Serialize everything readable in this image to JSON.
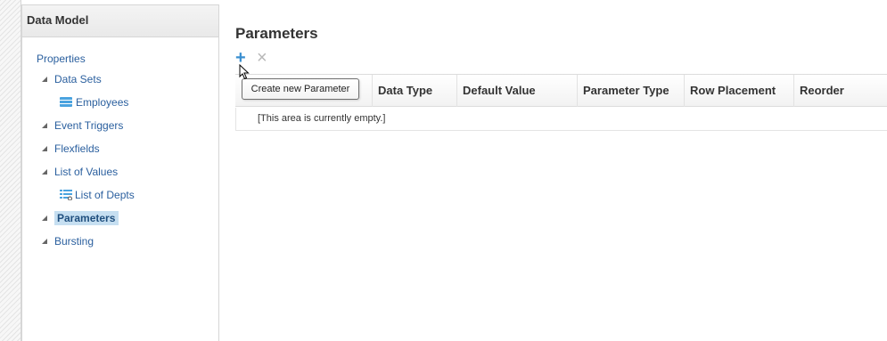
{
  "left_panel": {
    "title": "Data Model",
    "root": "Properties",
    "items": [
      {
        "label": "Data Sets",
        "icon": "triangle-expanded-icon"
      },
      {
        "label": "Employees",
        "icon": "data-set-icon"
      },
      {
        "label": "Event Triggers",
        "icon": "triangle-expanded-icon"
      },
      {
        "label": "Flexfields",
        "icon": "triangle-expanded-icon"
      },
      {
        "label": "List of Values",
        "icon": "triangle-expanded-icon"
      },
      {
        "label": "List of Depts",
        "icon": "list-of-values-icon"
      },
      {
        "label": "Parameters",
        "icon": "triangle-expanded-icon",
        "selected": true
      },
      {
        "label": "Bursting",
        "icon": "triangle-expanded-icon"
      }
    ]
  },
  "main": {
    "title": "Parameters",
    "toolbar": {
      "add_icon": "plus-icon",
      "delete_icon": "x-icon"
    },
    "tooltip": "Create new Parameter",
    "table": {
      "headers": [
        "Data Type",
        "Default Value",
        "Parameter Type",
        "Row Placement",
        "Reorder"
      ],
      "empty_text": "[This area is currently empty.]"
    }
  },
  "colors": {
    "link": "#2a5f9e",
    "selected_bg": "#c6dff1",
    "add_icon": "#3a8fd0",
    "delete_icon": "#b8b8b8"
  }
}
